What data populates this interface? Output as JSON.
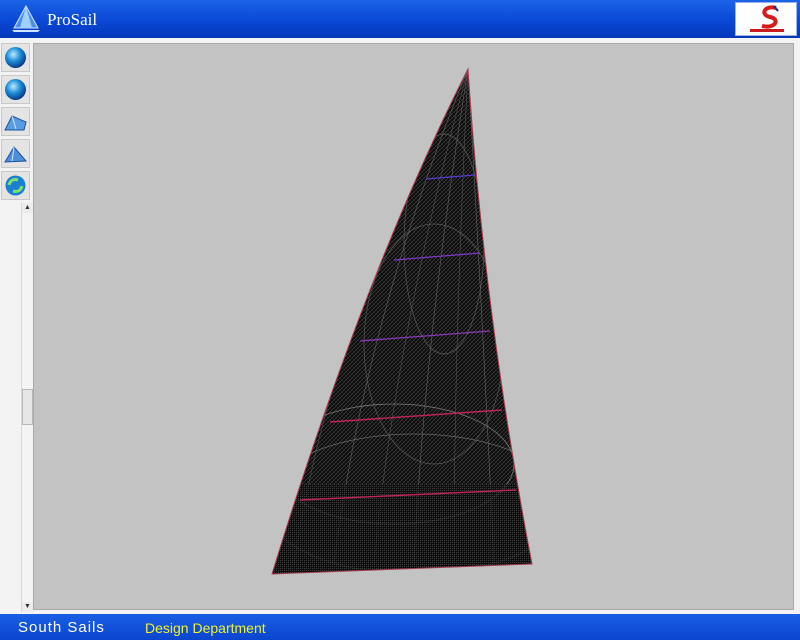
{
  "window": {
    "title": "ProSail"
  },
  "header": {
    "brand_logo": "south-sails-logo"
  },
  "toolbar": {
    "buttons": [
      {
        "icon": "globe-icon"
      },
      {
        "icon": "globe-icon"
      },
      {
        "icon": "sail-view-icon"
      },
      {
        "icon": "sail-view-icon"
      },
      {
        "icon": "refresh-globe-icon"
      }
    ]
  },
  "viewport": {
    "background": "#c3c3c3",
    "content": "sail-mesh-3d-view"
  },
  "footer": {
    "company": "South Sails",
    "department": "Design Department"
  },
  "colors": {
    "title_bar": "#0a47d6",
    "footer_text": "#f3f32a",
    "sail_fill": "#0d0d0d",
    "seam_red": "#c0245a",
    "seam_blue": "#5a3ad8"
  }
}
